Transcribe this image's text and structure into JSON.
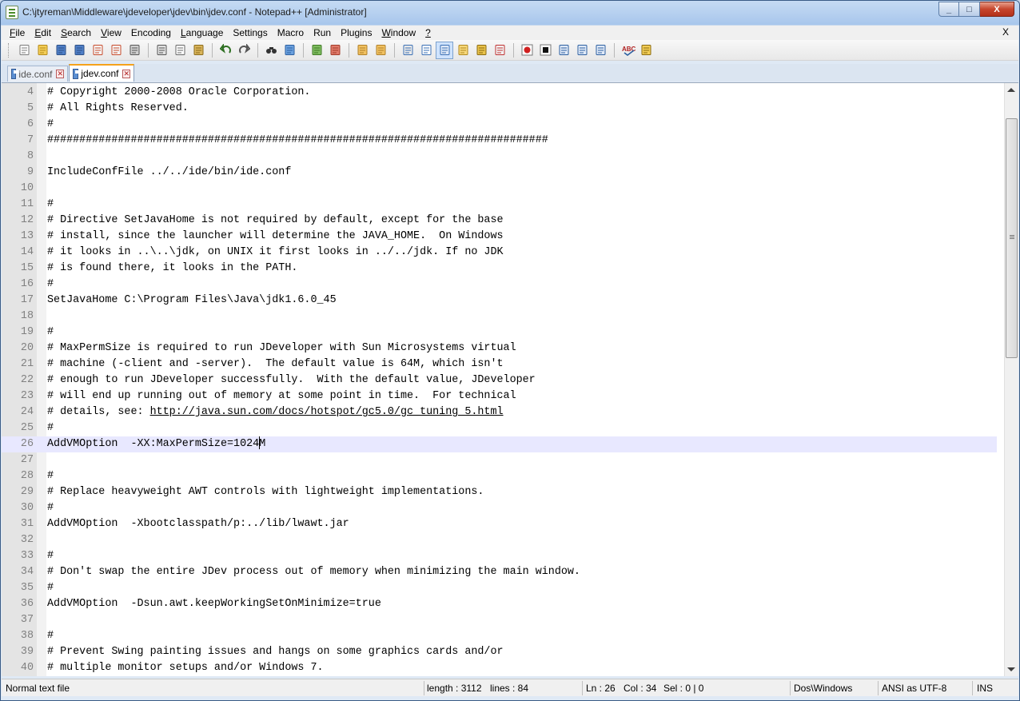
{
  "window": {
    "title": "C:\\jtyreman\\Middleware\\jdeveloper\\jdev\\bin\\jdev.conf - Notepad++ [Administrator]",
    "minimize_glyph": "_",
    "maximize_glyph": "□",
    "close_glyph": "X"
  },
  "menu": {
    "items": [
      {
        "label": "File",
        "key": "F",
        "rest": "ile"
      },
      {
        "label": "Edit",
        "key": "E",
        "rest": "dit"
      },
      {
        "label": "Search",
        "key": "S",
        "rest": "earch"
      },
      {
        "label": "View",
        "key": "V",
        "rest": "iew"
      },
      {
        "label": "Encoding",
        "key": "",
        "rest": "Encoding"
      },
      {
        "label": "Language",
        "key": "L",
        "rest": "anguage"
      },
      {
        "label": "Settings",
        "key": "",
        "rest": "Settings"
      },
      {
        "label": "Macro",
        "key": "",
        "rest": "Macro"
      },
      {
        "label": "Run",
        "key": "",
        "rest": "Run"
      },
      {
        "label": "Plugins",
        "key": "",
        "rest": "Plugins"
      },
      {
        "label": "Window",
        "key": "W",
        "rest": "indow"
      },
      {
        "label": "?",
        "key": "?",
        "rest": ""
      }
    ],
    "close_label": "X"
  },
  "toolbar": {
    "groups": [
      [
        "new-file-icon",
        "open-file-icon",
        "save-icon",
        "save-all-icon",
        "close-icon",
        "close-all-icon",
        "print-icon"
      ],
      [
        "cut-icon",
        "copy-icon",
        "paste-icon"
      ],
      [
        "undo-icon",
        "redo-icon"
      ],
      [
        "find-icon",
        "replace-icon"
      ],
      [
        "zoom-in-icon",
        "zoom-out-icon"
      ],
      [
        "sync-vertical-icon",
        "sync-horizontal-icon"
      ],
      [
        "word-wrap-icon",
        "show-all-chars-icon",
        "indent-guide-icon",
        "user-lang-icon",
        "doc-map-icon",
        "function-list-icon"
      ],
      [
        "record-macro-icon",
        "stop-macro-icon",
        "play-macro-icon",
        "run-macro-multiple-icon",
        "save-macro-icon"
      ],
      [
        "spell-check-icon",
        "spell-options-icon"
      ]
    ],
    "active": "indent-guide-icon",
    "spell_label": "ABC"
  },
  "tabs": [
    {
      "label": "ide.conf",
      "active": false
    },
    {
      "label": "jdev.conf",
      "active": true
    }
  ],
  "editor": {
    "current_line": 26,
    "lines": [
      {
        "n": "4",
        "text": "# Copyright 2000-2008 Oracle Corporation."
      },
      {
        "n": "5",
        "text": "# All Rights Reserved."
      },
      {
        "n": "6",
        "text": "#"
      },
      {
        "n": "7",
        "text": "##############################################################################"
      },
      {
        "n": "8",
        "text": ""
      },
      {
        "n": "9",
        "text": "IncludeConfFile ../../ide/bin/ide.conf"
      },
      {
        "n": "10",
        "text": ""
      },
      {
        "n": "11",
        "text": "#"
      },
      {
        "n": "12",
        "text": "# Directive SetJavaHome is not required by default, except for the base"
      },
      {
        "n": "13",
        "text": "# install, since the launcher will determine the JAVA_HOME.  On Windows"
      },
      {
        "n": "14",
        "text": "# it looks in ..\\..\\jdk, on UNIX it first looks in ../../jdk. If no JDK"
      },
      {
        "n": "15",
        "text": "# is found there, it looks in the PATH."
      },
      {
        "n": "16",
        "text": "#"
      },
      {
        "n": "17",
        "text": "SetJavaHome C:\\Program Files\\Java\\jdk1.6.0_45"
      },
      {
        "n": "18",
        "text": ""
      },
      {
        "n": "19",
        "text": "#"
      },
      {
        "n": "20",
        "text": "# MaxPermSize is required to run JDeveloper with Sun Microsystems virtual"
      },
      {
        "n": "21",
        "text": "# machine (-client and -server).  The default value is 64M, which isn't"
      },
      {
        "n": "22",
        "text": "# enough to run JDeveloper successfully.  With the default value, JDeveloper"
      },
      {
        "n": "23",
        "text": "# will end up running out of memory at some point in time.  For technical"
      },
      {
        "n": "24",
        "text": "# details, see: ",
        "link": "http://java.sun.com/docs/hotspot/gc5.0/gc_tuning_5.html"
      },
      {
        "n": "25",
        "text": "#"
      },
      {
        "n": "26",
        "text": "AddVMOption  -XX:MaxPermSize=1024",
        "after_caret": "M"
      },
      {
        "n": "27",
        "text": ""
      },
      {
        "n": "28",
        "text": "#"
      },
      {
        "n": "29",
        "text": "# Replace heavyweight AWT controls with lightweight implementations."
      },
      {
        "n": "30",
        "text": "#"
      },
      {
        "n": "31",
        "text": "AddVMOption  -Xbootclasspath/p:../lib/lwawt.jar"
      },
      {
        "n": "32",
        "text": ""
      },
      {
        "n": "33",
        "text": "#"
      },
      {
        "n": "34",
        "text": "# Don't swap the entire JDev process out of memory when minimizing the main window."
      },
      {
        "n": "35",
        "text": "#"
      },
      {
        "n": "36",
        "text": "AddVMOption  -Dsun.awt.keepWorkingSetOnMinimize=true"
      },
      {
        "n": "37",
        "text": ""
      },
      {
        "n": "38",
        "text": "#"
      },
      {
        "n": "39",
        "text": "# Prevent Swing painting issues and hangs on some graphics cards and/or"
      },
      {
        "n": "40",
        "text": "# multiple monitor setups and/or Windows 7."
      }
    ]
  },
  "status": {
    "doc_type": "Normal text file",
    "length": "length : 3112",
    "lines": "lines : 84",
    "ln": "Ln : 26",
    "col": "Col : 34",
    "sel": "Sel : 0 | 0",
    "eol": "Dos\\Windows",
    "encoding": "ANSI as UTF-8",
    "mode": "INS"
  }
}
